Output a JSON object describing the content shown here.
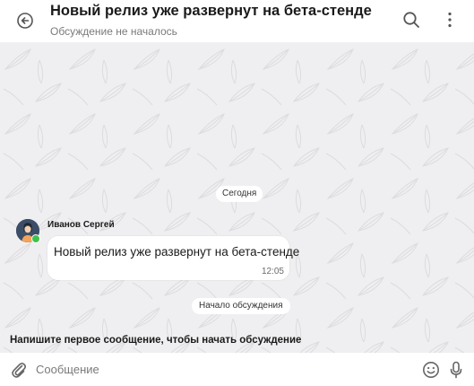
{
  "header": {
    "title": "Новый релиз уже развернут на бета-стенде",
    "subtitle": "Обсуждение не началось",
    "back_icon": "back-arrow-icon",
    "search_icon": "search-icon",
    "more_icon": "more-vertical-icon"
  },
  "chat": {
    "date_separator": "Сегодня",
    "message": {
      "author": "Иванов Сергей",
      "text": "Новый релиз уже развернут на бета-стенде",
      "time": "12:05",
      "author_online": true
    },
    "discussion_start": "Начало обсуждения",
    "hint": "Напишите первое сообщение, чтобы начать обсуждение"
  },
  "composer": {
    "placeholder": "Сообщение",
    "value": "",
    "attach_icon": "paperclip-icon",
    "emoji_icon": "emoji-icon",
    "mic_icon": "microphone-icon"
  },
  "colors": {
    "chat_background": "#efeff1",
    "online": "#3fc24a",
    "avatar_background": "#3c4e67"
  }
}
